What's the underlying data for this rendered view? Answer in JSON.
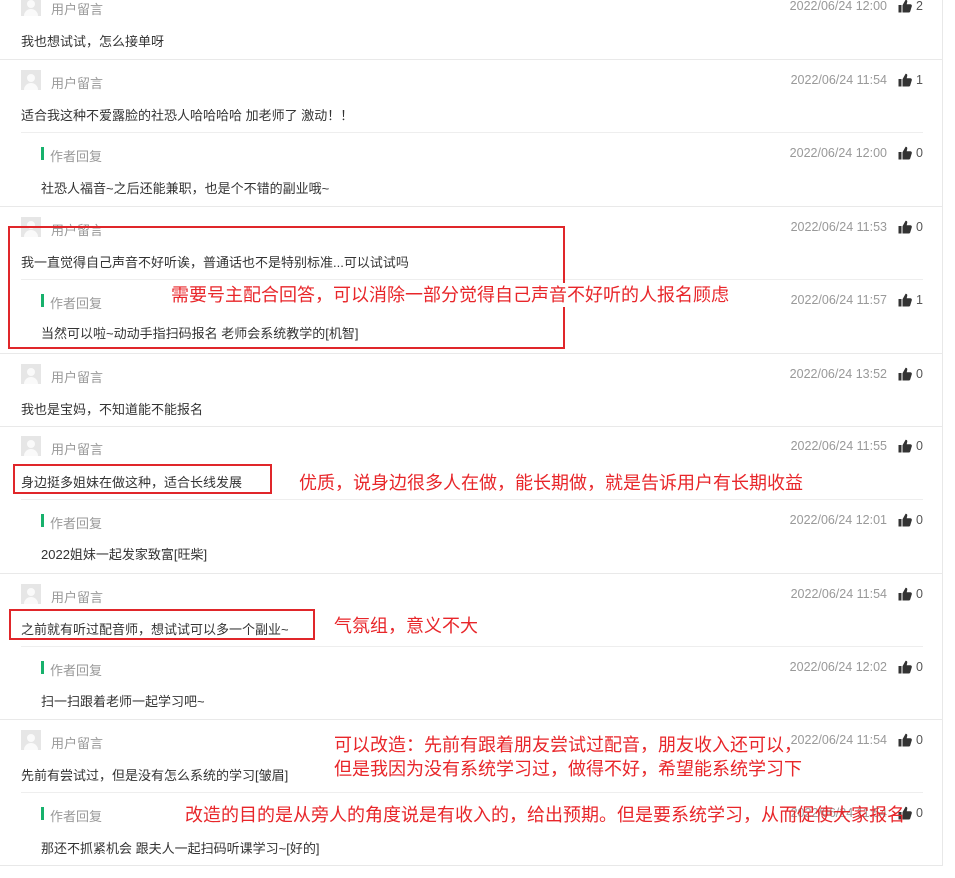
{
  "comments": [
    {
      "user": "用户留言",
      "time": "2022/06/24 12:00",
      "likes": "2",
      "text": "我也想试试，怎么接单呀"
    },
    {
      "user": "用户留言",
      "time": "2022/06/24 11:54",
      "likes": "1",
      "text": "适合我这种不爱露脸的社恐人哈哈哈哈 加老师了 激动！！",
      "reply": {
        "label": "作者回复",
        "time": "2022/06/24 12:00",
        "likes": "0",
        "text": "社恐人福音~之后还能兼职，也是个不错的副业哦~"
      }
    },
    {
      "user": "用户留言",
      "time": "2022/06/24 11:53",
      "likes": "0",
      "text": "我一直觉得自己声音不好听诶，普通话也不是特别标准...可以试试吗",
      "reply": {
        "label": "作者回复",
        "time": "2022/06/24 11:57",
        "likes": "1",
        "text": "当然可以啦~动动手指扫码报名 老师会系统教学的[机智]"
      }
    },
    {
      "user": "用户留言",
      "time": "2022/06/24 13:52",
      "likes": "0",
      "text": "我也是宝妈，不知道能不能报名"
    },
    {
      "user": "用户留言",
      "time": "2022/06/24 11:55",
      "likes": "0",
      "text": "身边挺多姐妹在做这种，适合长线发展",
      "reply": {
        "label": "作者回复",
        "time": "2022/06/24 12:01",
        "likes": "0",
        "text": "2022姐妹一起发家致富[旺柴]"
      }
    },
    {
      "user": "用户留言",
      "time": "2022/06/24 11:54",
      "likes": "0",
      "text": "之前就有听过配音师，想试试可以多一个副业~",
      "reply": {
        "label": "作者回复",
        "time": "2022/06/24 12:02",
        "likes": "0",
        "text": "扫一扫跟着老师一起学习吧~"
      }
    },
    {
      "user": "用户留言",
      "time": "2022/06/24 11:54",
      "likes": "0",
      "text": "先前有尝试过，但是没有怎么系统的学习[皱眉]",
      "reply": {
        "label": "作者回复",
        "time": "2022/06/24 11:54",
        "likes": "0",
        "text": "那还不抓紧机会 跟夫人一起扫码听课学习~[好的]"
      }
    }
  ],
  "annotations": {
    "a1": "需要号主配合回答，可以消除一部分觉得自己声音不好听的人报名顾虑",
    "a2": "优质，说身边很多人在做，能长期做，就是告诉用户有长期收益",
    "a3": "气氛组，意义不大",
    "a4_line1": "可以改造：先前有跟着朋友尝试过配音，朋友收入还可以，",
    "a4_line2": "但是我因为没有系统学习过，做得不好，希望能系统学习下",
    "a5": "改造的目的是从旁人的角度说是有收入的，给出预期。但是要系统学习，从而促使大家报名"
  },
  "colors": {
    "accent": "#17b16c",
    "annotation": "#e8262a"
  },
  "icons": {
    "like": "thumbs-up-icon",
    "avatar": "default-avatar-icon"
  }
}
